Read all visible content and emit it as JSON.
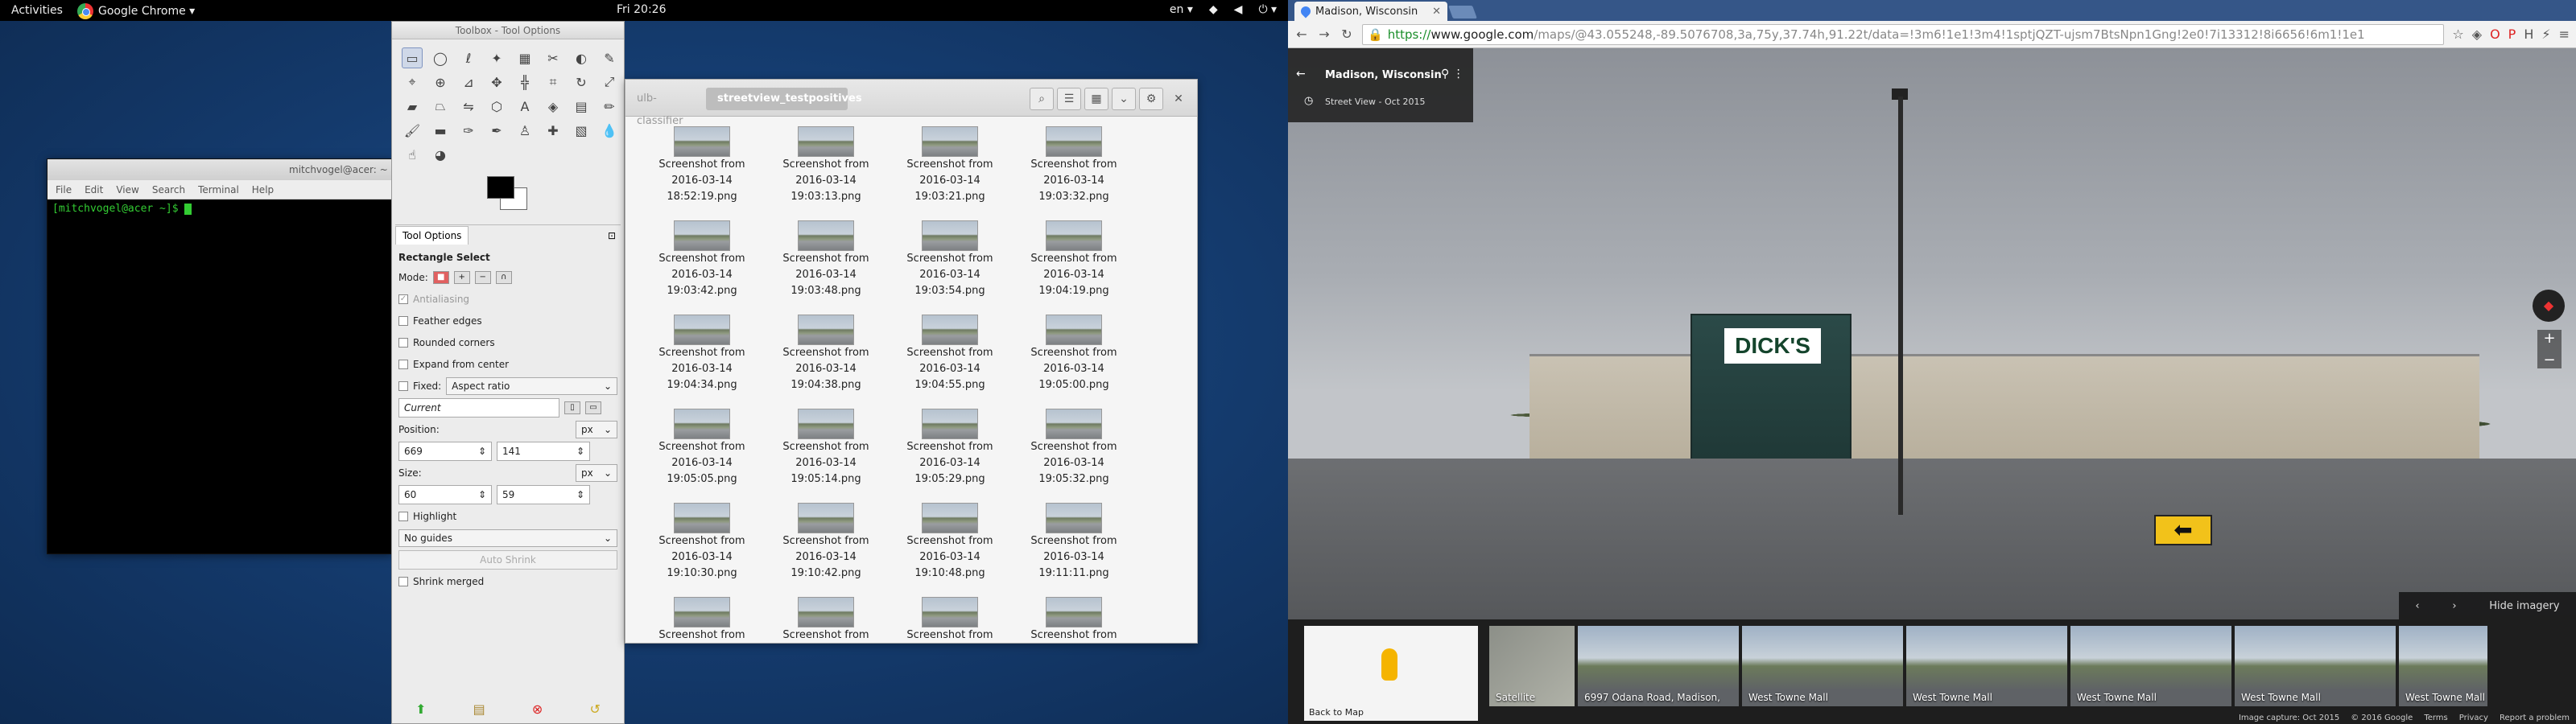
{
  "topbar": {
    "activities": "Activities",
    "app_name": "Google Chrome ▾",
    "clock": "Fri 20:26",
    "lang": "en ▾",
    "status_icons": [
      "wifi-icon",
      "volume-icon",
      "power-icon"
    ]
  },
  "terminal": {
    "title": "mitchvogel@acer: ~",
    "menu": [
      "File",
      "Edit",
      "View",
      "Search",
      "Terminal",
      "Help"
    ],
    "prompt": "[mitchvogel@acer ~]$ "
  },
  "toolbox": {
    "title": "Toolbox - Tool Options",
    "tab_label": "Tool Options",
    "tool_name": "Rectangle Select",
    "mode_label": "Mode:",
    "antialiasing": "Antialiasing",
    "feather": "Feather edges",
    "rounded": "Rounded corners",
    "expand": "Expand from center",
    "fixed_label": "Fixed:",
    "fixed_value": "Aspect ratio",
    "current": "Current",
    "position_label": "Position:",
    "size_label": "Size:",
    "unit": "px",
    "pos_x": "669",
    "pos_y": "141",
    "size_w": "60",
    "size_h": "59",
    "highlight": "Highlight",
    "guides": "No guides",
    "auto_shrink": "Auto Shrink",
    "shrink_merged": "Shrink merged"
  },
  "files": {
    "crumb_parent": "ulb-classifier",
    "crumb_current": "streetview_testpositives",
    "items": [
      {
        "l1": "Screenshot from",
        "l2": "2016-03-14",
        "l3": "18:52:19.png"
      },
      {
        "l1": "Screenshot from",
        "l2": "2016-03-14",
        "l3": "19:03:13.png"
      },
      {
        "l1": "Screenshot from",
        "l2": "2016-03-14",
        "l3": "19:03:21.png"
      },
      {
        "l1": "Screenshot from",
        "l2": "2016-03-14",
        "l3": "19:03:32.png"
      },
      {
        "l1": "Screenshot from",
        "l2": "2016-03-14",
        "l3": "19:03:42.png"
      },
      {
        "l1": "Screenshot from",
        "l2": "2016-03-14",
        "l3": "19:03:48.png"
      },
      {
        "l1": "Screenshot from",
        "l2": "2016-03-14",
        "l3": "19:03:54.png"
      },
      {
        "l1": "Screenshot from",
        "l2": "2016-03-14",
        "l3": "19:04:19.png"
      },
      {
        "l1": "Screenshot from",
        "l2": "2016-03-14",
        "l3": "19:04:34.png"
      },
      {
        "l1": "Screenshot from",
        "l2": "2016-03-14",
        "l3": "19:04:38.png"
      },
      {
        "l1": "Screenshot from",
        "l2": "2016-03-14",
        "l3": "19:04:55.png"
      },
      {
        "l1": "Screenshot from",
        "l2": "2016-03-14",
        "l3": "19:05:00.png"
      },
      {
        "l1": "Screenshot from",
        "l2": "2016-03-14",
        "l3": "19:05:05.png"
      },
      {
        "l1": "Screenshot from",
        "l2": "2016-03-14",
        "l3": "19:05:14.png"
      },
      {
        "l1": "Screenshot from",
        "l2": "2016-03-14",
        "l3": "19:05:29.png"
      },
      {
        "l1": "Screenshot from",
        "l2": "2016-03-14",
        "l3": "19:05:32.png"
      },
      {
        "l1": "Screenshot from",
        "l2": "2016-03-14",
        "l3": "19:10:30.png"
      },
      {
        "l1": "Screenshot from",
        "l2": "2016-03-14",
        "l3": "19:10:42.png"
      },
      {
        "l1": "Screenshot from",
        "l2": "2016-03-14",
        "l3": "19:10:48.png"
      },
      {
        "l1": "Screenshot from",
        "l2": "2016-03-14",
        "l3": "19:11:11.png"
      },
      {
        "l1": "Screenshot from",
        "l2": "",
        "l3": ""
      },
      {
        "l1": "Screenshot from",
        "l2": "",
        "l3": ""
      },
      {
        "l1": "Screenshot from",
        "l2": "",
        "l3": ""
      },
      {
        "l1": "Screenshot from",
        "l2": "",
        "l3": ""
      }
    ]
  },
  "chrome": {
    "tab_title": "Madison, Wisconsin",
    "url_https": "https://",
    "url_host": "www.google.com",
    "url_rest": "/maps/@43.055248,-89.5076708,3a,75y,37.74h,91.22t/data=!3m6!1e1!3m4!1sptjQZT-ujsm7BtsNpn1Gng!2e0!7i13312!8i6656!6m1!1e1",
    "place": "Madison, Wisconsin",
    "sv_date": "Street View - Oct 2015",
    "store_sign": "DICK'S",
    "hide_imagery": "Hide imagery",
    "back_to_map": "Back to Map",
    "satellite": "Satellite",
    "thumbs": [
      "6997 Odana Road, Madison,",
      "West Towne Mall",
      "West Towne Mall",
      "West Towne Mall",
      "West Towne Mall",
      "West Towne Mall"
    ],
    "footer": [
      "Image capture: Oct 2015",
      "© 2016 Google",
      "Terms",
      "Privacy",
      "Report a problem"
    ]
  }
}
